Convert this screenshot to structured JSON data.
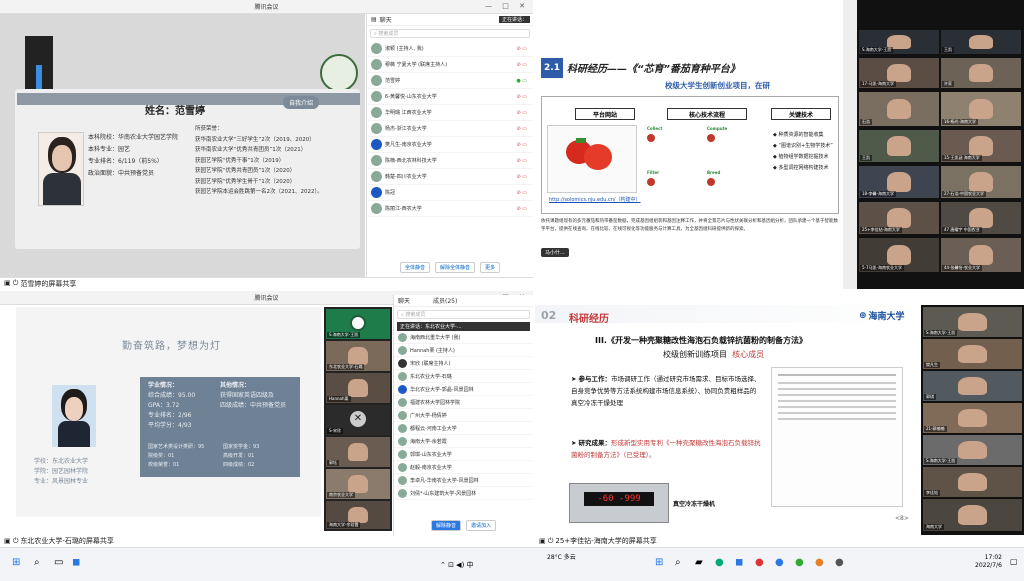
{
  "top_left": {
    "window_title": "腾讯会议",
    "share_label": "范雪婷的屏幕共享",
    "level_value": "20",
    "slide": {
      "name": "姓名：范雪婷",
      "tag": "自我介绍",
      "info_lines": [
        "本科院校：华南农业大学园艺学院",
        "本科专业：园艺",
        "专业排名：6/119（前5%）",
        "政治面貌：中共预备党员"
      ],
      "awards_title": "所获荣誉：",
      "awards": [
        "获华南农业大学“三好学生”2次（2019、2020）",
        "获华南农业大学“优秀共青团员”1次（2021）",
        "获园艺学院“优秀干事”1次（2019）",
        "获园艺学院“优秀共青团员”1次（2020）",
        "获园艺学院“优秀学生骨干”1次（2020）",
        "获园艺学院本运会胜跳第一名2次（2021、2022）。"
      ]
    },
    "chat": {
      "title": "聊天",
      "speaking": "正在讲话：",
      "search_placeholder": "搜索成员",
      "members": [
        "淑颖 (主持人, 我)",
        "穆薇 宁夏大学 (联席主持人)",
        "范雪婷",
        "6-黄馨悦-山东农业大学",
        "华明璐 江西农业大学",
        "杨杰-浙江农业大学",
        "樊凡生-南京农业大学",
        "陈楠-西北农林科技大学",
        "韩楚-四川农业大学",
        "陈冠",
        "陈丽江-西农大学"
      ],
      "btn_mute_all": "全体静音",
      "btn_unmute_all": "解除全体静音",
      "btn_more": "更多"
    }
  },
  "top_right": {
    "slide_num": "2.1",
    "title": "科研经历——《“芯育”番茄育种平台》",
    "subtitle": "校级大学生创新创业项目，在研",
    "cols": [
      "平台网站",
      "核心技术流程",
      "关键技术"
    ],
    "flow": [
      "Collect",
      "Compute",
      "Filter",
      "Breed"
    ],
    "key_tech": [
      "种质资源的智能收集",
      "“图谱识别+生物学技术”",
      "植物组学数据挖掘技术",
      "多型调控网络构建技术"
    ],
    "url": "http://solomics.nju.edu.cn/（构建中）",
    "paragraph": "依托课题组现有的多元番茄和热带番茄数据，完成基因组组装和基因注释工作，并将全景芯片与性状关联分析和基因组分析，团队承建一个基于智能数字平台，提供在线查询、在线比较、在线可视化等功能服务与计算工具，为全基因组科研提供新的探索。",
    "status": "马小什..."
  },
  "bottom_left": {
    "window_title": "腾讯会议",
    "share_label": "东北农业大学-石璐的屏幕共享",
    "slide": {
      "motto": "勤奋筑路，梦想为灯",
      "study_title": "学业情况：",
      "study": [
        "综合成绩：95.00",
        "GPA：3.72",
        "专业排名：2/96",
        "平均学分：4/93"
      ],
      "other_title": "其他情况：",
      "other": [
        "获得国家英语四级及",
        "四级成绩：中共预备党员"
      ],
      "extra": [
        "国家艺术类设计类研：95",
        "国家奖学金：93",
        "院级奖：01",
        "高级开发：01",
        "校级荣誉：01",
        "四级成绩：02"
      ],
      "school": "学校：东北农业大学",
      "college": "学院：园艺园林学院",
      "major": "专业：风景园林专业"
    },
    "participants": {
      "tab_chat": "聊天",
      "tab_members": "成员(25)",
      "search_placeholder": "搜索成员",
      "speaking": "正在讲话：东北农业大学-...",
      "members": [
        "海南西北重华大学 (我)",
        "Hannah栗 (主持人)",
        "宋欣 (联席主持人)",
        "东北农业大学-石璐",
        "华北农业大学-郭晶-风景园林",
        "福建农林大学园林学院",
        "广州大学-杨倩婷",
        "都程云-河南工业大学",
        "海南大学-余若霞",
        "郭琪-山东农业大学",
        "赵毅-南京农业大学",
        "李卓凡-华南农业大学-风景园林",
        "刘倩*-山东建筑大学-风景园林"
      ],
      "btn_mute": "解除静音",
      "btn_invite": "邀请加入"
    },
    "videos": [
      "S.海南大学-王凯",
      "东北农业大学-石璐",
      "Hannah栗",
      "S-宋欣",
      "郭钰",
      "南京农业大学",
      "海南大学-余若霞"
    ]
  },
  "bottom_right": {
    "section_num": "02",
    "section": "科研经历",
    "logo_text": "海南大学",
    "title": "III.《开发一种壳聚糖改性海泡石负载锌抗菌粉的制备方法》",
    "subtitle_plain": "校级创新训练项目",
    "subtitle_role": "核心成员",
    "bullet1_head": "参与工作：",
    "bullet1_body": "市场调研工作（通过研究市场需求、目标市场选择、自身竞争优势等方法系统构建市场信息系统）、协同负责粗样品的真空冷冻干燥处理",
    "bullet2_head": "研究成果：",
    "bullet2_body": "形成新型实用专利《一种壳聚糖改性海泡石负载锌抗菌粉的制备方法》（已受理）。",
    "device_display": "-60  -999",
    "device_label": "真空冷冻干燥机",
    "page": "<8>",
    "share_label": "25+李佳钻-海南大学的屏幕共享",
    "videos": [
      "S.海南大学-王凯",
      "樊凡生",
      "郭琪",
      "21-郭楠楠",
      "S.海南大学-王凯",
      "李佳钻",
      "海南大学"
    ]
  },
  "top_right_videos": [
    "S.海南大学-王凯",
    "王凯",
    "17-马凯-海南大学",
    "许家",
    "石浩",
    "16-杨光-海南大学",
    "王凯",
    "15-王凯涵 海南大学",
    "18-李馨-海南大学",
    "27-石浩-中国农业大学",
    "25+李佳钻-海南大学",
    "47 唐耀宇 中国农业",
    "5-7马凯-海南农业大学",
    "44-张馨怡-农业大学"
  ],
  "taskbar": {
    "time": "17:02",
    "date": "2022/7/6",
    "weather": "28°C 多云"
  }
}
